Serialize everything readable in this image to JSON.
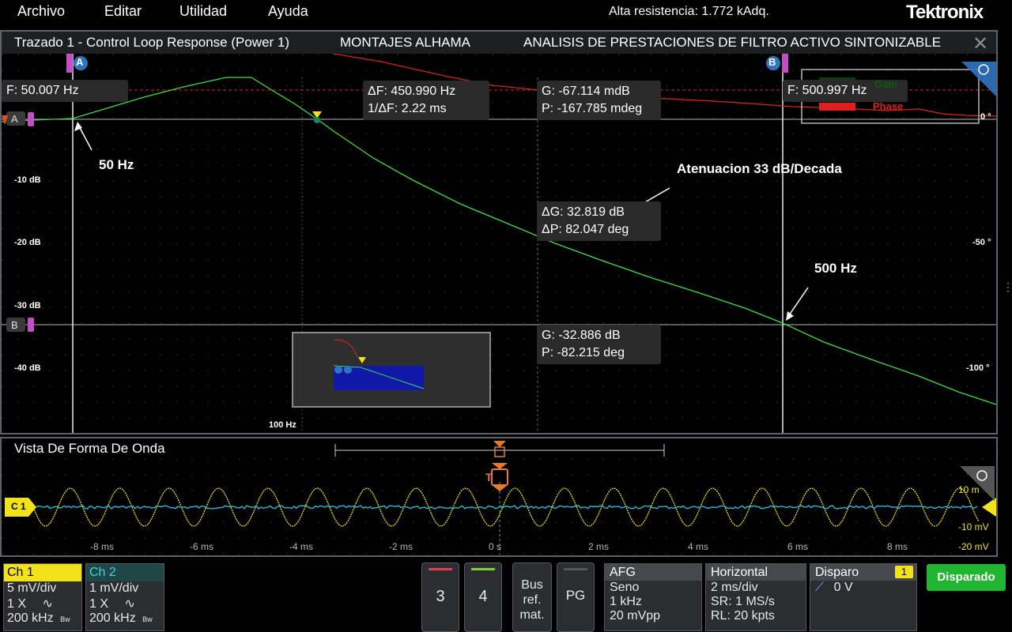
{
  "menu": {
    "items": [
      "Archivo",
      "Editar",
      "Utilidad",
      "Ayuda"
    ],
    "status": "Alta resistencia: 1.772 kAdq.",
    "brand": "Tektronix"
  },
  "plot": {
    "title": "Trazado 1 - Control Loop Response (Power 1)",
    "subtitle": "MONTAJES ALHAMA",
    "title_right": "ANALISIS DE PRESTACIONES DE FILTRO ACTIVO SINTONIZABLE",
    "close": "✕",
    "cursor_a_label": "A",
    "cursor_b_label": "B",
    "marker_a": "A",
    "marker_b": "B",
    "freq_a": "F: 50.007 Hz",
    "freq_b": "F: 500.997 Hz",
    "delta_f": "ΔF: 450.990 Hz",
    "inv_delta_f": "1/ΔF: 2.22 ms",
    "top_g": "G: -67.114 mdB",
    "top_p": "P: -167.785 mdeg",
    "delta_g": "ΔG: 32.819 dB",
    "delta_p": "ΔP: 82.047 deg",
    "bot_g": "G: -32.886 dB",
    "bot_p": "P: -82.215 deg",
    "legend_gain": "Gain",
    "legend_phase": "Phase",
    "y_left_ticks": [
      "-10 dB",
      "-20 dB",
      "-30 dB",
      "-40 dB"
    ],
    "y_right_ticks": [
      "0 °",
      "-50 °",
      "-100 °"
    ],
    "x_tick": "100 Hz",
    "annot_50": "50 Hz",
    "annot_500": "500 Hz",
    "annot_atten": "Atenuacion 33 dB/Decada",
    "colors": {
      "gain": "#3fdc3f",
      "phase": "#e02020",
      "marker": "#2f74c0"
    }
  },
  "wave": {
    "title": "Vista De Forma De Onda",
    "ch_label": "C 1",
    "trigger_label": "T",
    "x_ticks": [
      "-8 ms",
      "-6 ms",
      "-4 ms",
      "-2 ms",
      "0 s",
      "2 ms",
      "4 ms",
      "6 ms",
      "8 ms"
    ],
    "y_ticks": [
      "10 m",
      "-10 mV",
      "-20 mV"
    ]
  },
  "bottom": {
    "ch1": {
      "title": "Ch 1",
      "scale": "5 mV/div",
      "probe": "1 X",
      "bw": "200 kHz"
    },
    "ch2": {
      "title": "Ch 2",
      "scale": "1 mV/div",
      "probe": "1 X",
      "bw": "200 kHz"
    },
    "bw_mark": "Bw",
    "btn3": "3",
    "btn4": "4",
    "bus": [
      "Bus",
      "ref.",
      "mat."
    ],
    "pg": "PG",
    "afg": {
      "title": "AFG",
      "l1": "Seno",
      "l2": "1 kHz",
      "l3": "20 mVpp"
    },
    "horizontal": {
      "title": "Horizontal",
      "l1": "2 ms/div",
      "l2": "SR: 1 MS/s",
      "l3": "RL: 20 kpts"
    },
    "trigger": {
      "title": "Disparo",
      "badge": "1",
      "l1": "0 V"
    },
    "state": "Disparado"
  }
}
